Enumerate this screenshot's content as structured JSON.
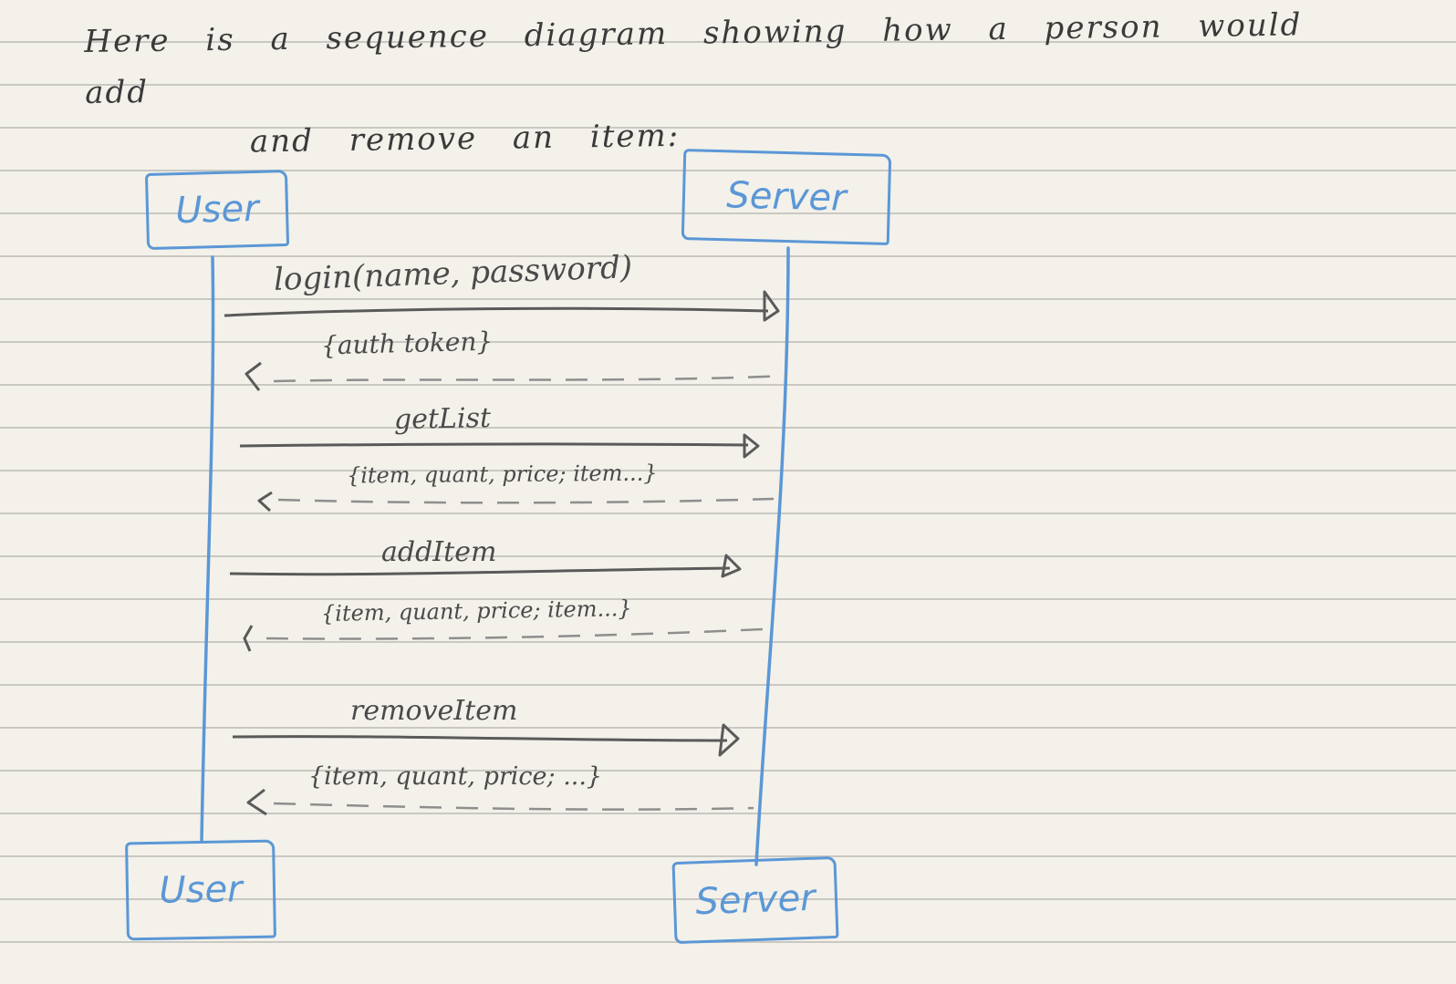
{
  "heading": {
    "line1": "Here is a sequence diagram showing how a person would add",
    "line2": "and remove an item:"
  },
  "participants": {
    "user": "User",
    "server": "Server"
  },
  "messages": [
    {
      "call": "login(name, password)",
      "return": "{auth token}"
    },
    {
      "call": "getList",
      "return": "{item, quant, price; item...}"
    },
    {
      "call": "addItem",
      "return": "{item, quant, price; item...}"
    },
    {
      "call": "removeItem",
      "return": "{item, quant, price; ...}"
    }
  ],
  "colors": {
    "paper": "#f3f1ea",
    "rule": "#c9c8c2",
    "participant_ink": "#5b97d6",
    "arrow_ink": "#5a5a5a"
  }
}
